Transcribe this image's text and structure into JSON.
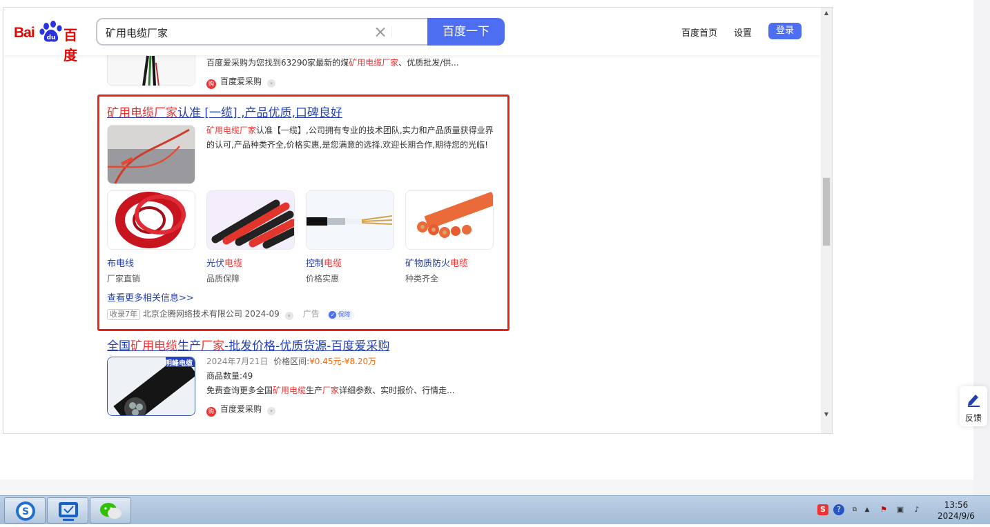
{
  "header": {
    "logo_text_left": "Bai",
    "logo_text_right": "百度",
    "logo_paw_text": "du",
    "search_value": "矿用电缆厂家",
    "search_button": "百度一下",
    "nav": [
      "百度首页",
      "设置"
    ],
    "login": "登录"
  },
  "result_top": {
    "desc_prefix": "百度爱采购为您找到63290家最新的煤",
    "desc_red": "矿用电缆厂家",
    "desc_suffix": "、优质批发/供...",
    "source": "百度爱采购"
  },
  "ad_result": {
    "title_red": "矿用电缆厂家",
    "title_rest": "认准 [一缆] ,产品优质,口碑良好",
    "desc_red": "矿用电缆厂家",
    "desc_rest": "认准【一缆】,公司拥有专业的技术团队,实力和产品质量获得业界的认可,产品种类齐全,价格实惠,是您满意的选择.欢迎长期合作,期待您的光临!",
    "products": [
      {
        "name_blue": "布电线",
        "name_red": "",
        "sub": "厂家直销"
      },
      {
        "name_blue": "光伏",
        "name_red": "电缆",
        "sub": "品质保障"
      },
      {
        "name_blue": "控制",
        "name_red": "电缆",
        "sub": "价格实惠"
      },
      {
        "name_blue": "矿物质防火",
        "name_red": "电缆",
        "sub": "种类齐全"
      }
    ],
    "more_link": "查看更多相关信息>>",
    "years_badge": "收录7年",
    "company": "北京企腾网络技术有限公司",
    "date": "2024-09",
    "ad_label": "广告",
    "guarantee": "保障"
  },
  "result_bottom": {
    "title_parts": [
      {
        "t": "全国",
        "red": false
      },
      {
        "t": "矿用电缆",
        "red": true
      },
      {
        "t": "生产",
        "red": false
      },
      {
        "t": "厂家",
        "red": true
      },
      {
        "t": "-批发价格-优质货源-百度爱采购",
        "red": false
      }
    ],
    "thumb_tag": "明峰电缆",
    "date": "2024年7月21日",
    "price_label": "价格区间:",
    "price": "¥0.45元-¥8.20万",
    "count": "商品数量:49",
    "desc_a": "免费查询更多全国",
    "desc_red1": "矿用电缆",
    "desc_b": "生产",
    "desc_red2": "厂家",
    "desc_c": "详细参数、实时报价、行情走...",
    "source": "百度爱采购"
  },
  "feedback": "反馈",
  "taskbar": {
    "time": "13:56",
    "date": "2024/9/6"
  },
  "colors": {
    "accent": "#4e6ef2",
    "link": "#2440b3",
    "highlight": "#f73131",
    "ad_box": "#e1251b",
    "price": "#f60"
  }
}
